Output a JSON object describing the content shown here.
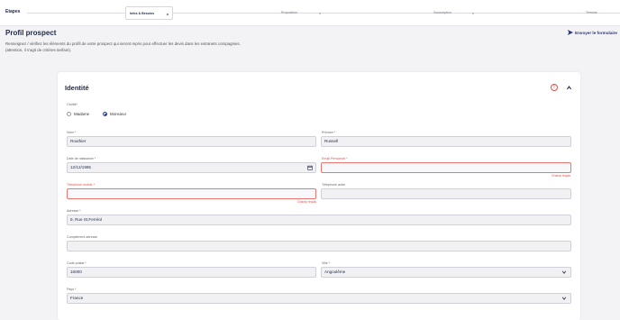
{
  "stepper": {
    "label": "Etapes",
    "steps": [
      {
        "label": "Infos & Besoins",
        "close": "x"
      },
      {
        "label": "Proposition",
        "close": "x"
      },
      {
        "label": "Souscription",
        "close": "x"
      },
      {
        "label": "Terminé",
        "close": ""
      }
    ]
  },
  "header": {
    "title": "Profil prospect",
    "send_label": "Envoyer le formulaire",
    "intro_line1": "Renseignez / vérifiez les éléments du profil de votre prospect qui seront repris pour effectuer les devis dans les extranets compagnies.",
    "intro_line2": "(attention, il s'agit de critères tarifant)."
  },
  "card": {
    "title": "Identité",
    "alert_icon": "!",
    "civilite": {
      "label": "Civilité*",
      "options": [
        "Madame",
        "Monsieur"
      ],
      "selected": "Monsieur"
    },
    "nom": {
      "label": "Nom *",
      "value": "Routhier"
    },
    "prenom": {
      "label": "Prénom *",
      "value": "Russell"
    },
    "date_naissance": {
      "label": "Date de naissance *",
      "value": "12/12/1985"
    },
    "email": {
      "label": "Email Personnel *",
      "value": "",
      "error": "Champ requis"
    },
    "tel_mobile": {
      "label": "Téléphone mobile *",
      "value": "",
      "error": "Champ requis"
    },
    "tel_autre": {
      "label": "Téléphone autre",
      "value": ""
    },
    "adresse": {
      "label": "Adresse *",
      "value": "9, Rue St.Ferréol"
    },
    "complement": {
      "label": "Complément adresse",
      "value": ""
    },
    "code_postal": {
      "label": "Code postal *",
      "value": "16000"
    },
    "ville": {
      "label": "Ville *",
      "value": "Angoulême"
    },
    "pays": {
      "label": "Pays *",
      "value": "France"
    }
  },
  "colors": {
    "accent": "#2b3b84",
    "error": "#e0504a"
  }
}
